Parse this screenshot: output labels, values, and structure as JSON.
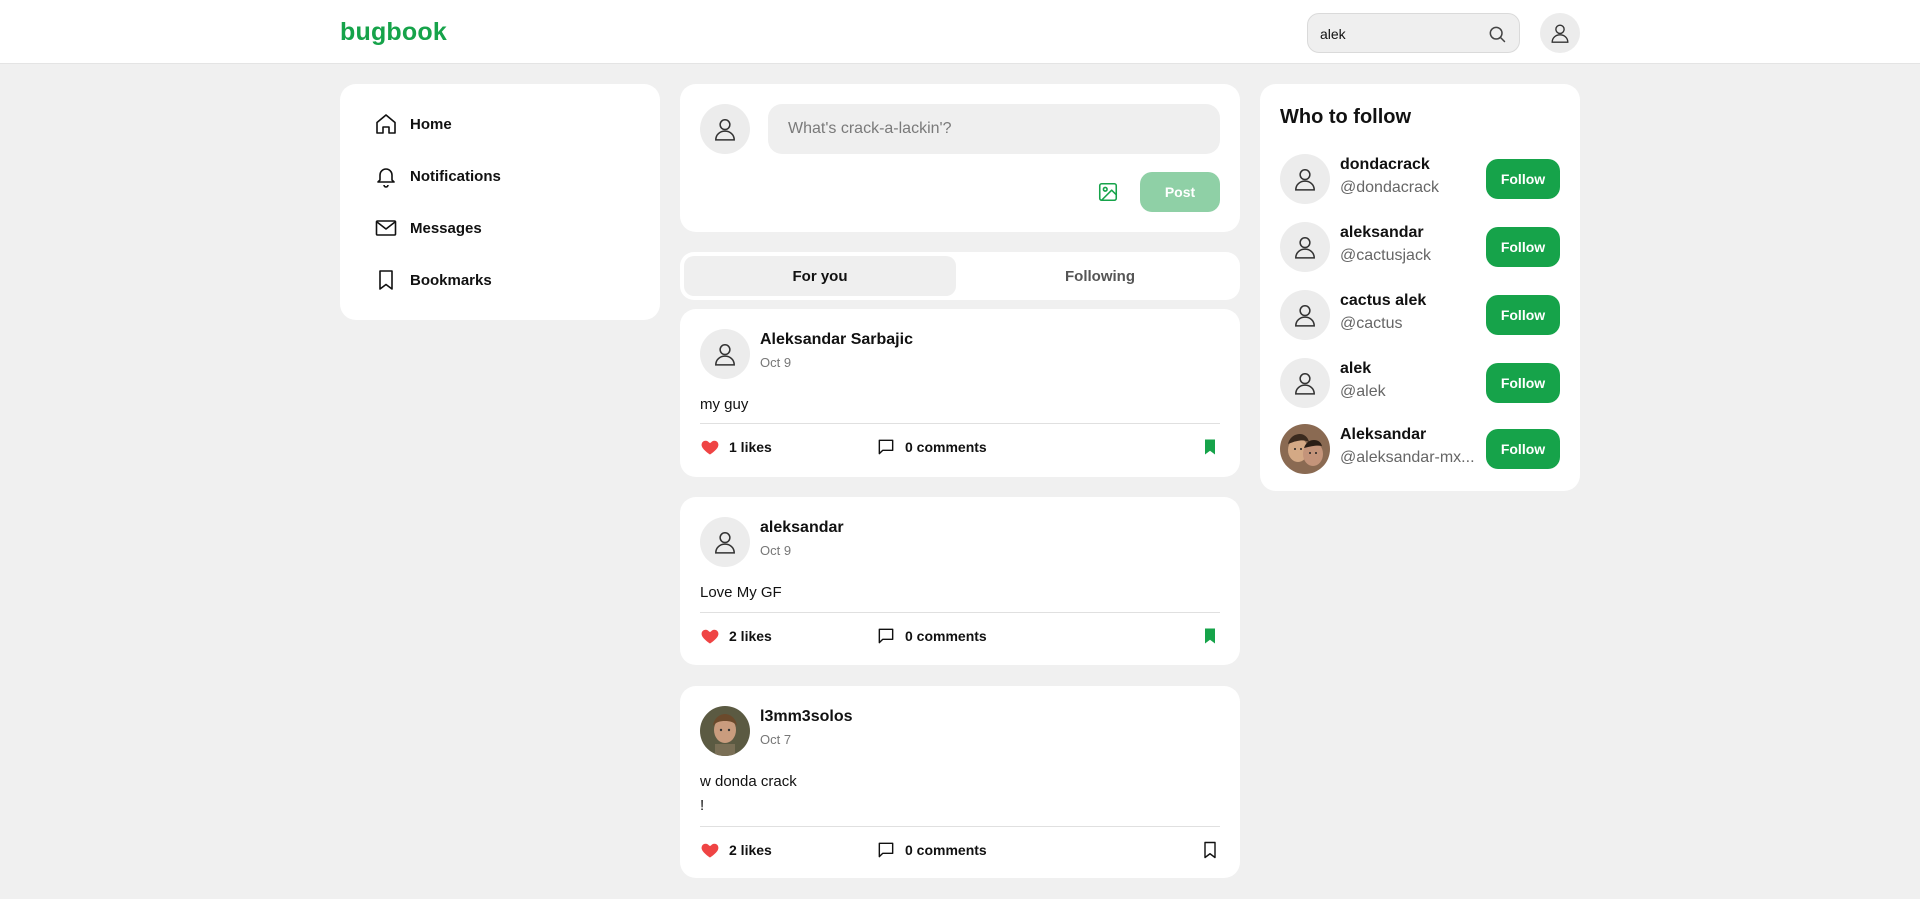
{
  "header": {
    "logo": "bugbook",
    "search_value": "alek"
  },
  "sidebar": {
    "items": [
      {
        "label": "Home",
        "icon": "home-icon"
      },
      {
        "label": "Notifications",
        "icon": "bell-icon"
      },
      {
        "label": "Messages",
        "icon": "mail-icon"
      },
      {
        "label": "Bookmarks",
        "icon": "bookmark-icon"
      }
    ]
  },
  "composer": {
    "placeholder": "What's crack-a-lackin'?",
    "post_label": "Post"
  },
  "tabs": [
    {
      "label": "For you",
      "active": true
    },
    {
      "label": "Following",
      "active": false
    }
  ],
  "posts": [
    {
      "author": "Aleksandar Sarbajic",
      "date": "Oct 9",
      "content": "my guy",
      "likes": "1 likes",
      "comments": "0 comments",
      "bookmarked": true
    },
    {
      "author": "aleksandar",
      "date": "Oct 9",
      "content": "Love My GF",
      "likes": "2 likes",
      "comments": "0 comments",
      "bookmarked": true
    },
    {
      "author": "l3mm3solos",
      "date": "Oct 7",
      "content": "w donda crack\n!",
      "likes": "2 likes",
      "comments": "0 comments",
      "bookmarked": false
    }
  ],
  "who_to_follow": {
    "title": "Who to follow",
    "button_label": "Follow",
    "users": [
      {
        "name": "dondacrack",
        "handle": "@dondacrack"
      },
      {
        "name": "aleksandar",
        "handle": "@cactusjack"
      },
      {
        "name": "cactus alek",
        "handle": "@cactus"
      },
      {
        "name": "alek",
        "handle": "@alek"
      },
      {
        "name": "Aleksandar",
        "handle": "@aleksandar-mx..."
      }
    ]
  },
  "colors": {
    "brand": "#16a34a",
    "like": "#ef4444",
    "bookmark": "#16a34a"
  }
}
